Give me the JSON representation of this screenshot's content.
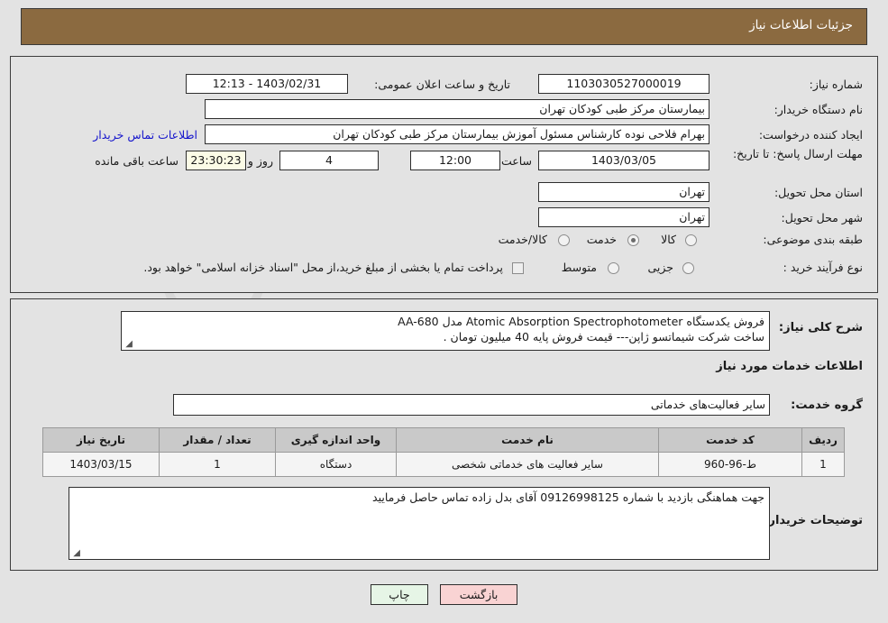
{
  "header": {
    "title": "جزئیات اطلاعات نیاز"
  },
  "watermark": {
    "text": "AnaTender.net"
  },
  "top_form": {
    "need_number": {
      "label": "شماره نیاز:",
      "value": "1103030527000019"
    },
    "announce_datetime": {
      "label": "تاریخ و ساعت اعلان عمومی:",
      "value": "1403/02/31 - 12:13"
    },
    "buyer_org": {
      "label": "نام دستگاه خریدار:",
      "value": "بیمارستان مرکز طبی کودکان تهران"
    },
    "requester": {
      "label": "ایجاد کننده درخواست:",
      "value": "بهرام فلاحی نوده کارشناس مسئول آموزش بیمارستان مرکز طبی کودکان تهران"
    },
    "contact_link": "اطلاعات تماس خریدار",
    "deadline": {
      "label": "مهلت ارسال پاسخ: تا تاریخ:",
      "date": "1403/03/05",
      "hour_label": "ساعت",
      "hour": "12:00",
      "days": "4",
      "days_suffix": "روز و",
      "countdown": "23:30:23",
      "countdown_suffix": "ساعت باقی مانده"
    },
    "province": {
      "label": "استان محل تحویل:",
      "value": "تهران"
    },
    "city": {
      "label": "شهر محل تحویل:",
      "value": "تهران"
    },
    "category": {
      "label": "طبقه بندی موضوعی:",
      "options": [
        "کالا",
        "خدمت",
        "کالا/خدمت"
      ],
      "selected": "خدمت"
    },
    "process_type": {
      "label": "نوع فرآیند خرید :",
      "options": [
        "جزیی",
        "متوسط"
      ],
      "selected": "",
      "treasury_note": "پرداخت تمام یا بخشی از مبلغ خرید،از محل \"اسناد خزانه اسلامی\" خواهد بود.",
      "treasury_checked": false
    }
  },
  "bottom": {
    "summary": {
      "label": "شرح کلی نیاز:",
      "line1": "فروش یکدستگاه Atomic Absorption Spectrophotometer مدل AA-680",
      "line2": "ساخت شرکت شیماتسو ژاپن--- قیمت فروش پایه 40 میلیون تومان ."
    },
    "services_section_title": "اطلاعات خدمات مورد نیاز",
    "service_group": {
      "label": "گروه خدمت:",
      "value": "سایر فعالیت‌های خدماتی"
    },
    "table": {
      "headers": [
        "ردیف",
        "کد خدمت",
        "نام خدمت",
        "واحد اندازه گیری",
        "تعداد / مقدار",
        "تاریخ نیاز"
      ],
      "rows": [
        [
          "1",
          "ط-96-960",
          "سایر فعالیت های خدماتی شخصی",
          "دستگاه",
          "1",
          "1403/03/15"
        ]
      ]
    },
    "buyer_notes": {
      "label": "توضیحات خریدار:",
      "value": "جهت هماهنگی بازدید با شماره 09126998125 آقای بدل زاده تماس حاصل فرمایید"
    }
  },
  "buttons": {
    "print": "چاپ",
    "back": "بازگشت"
  }
}
